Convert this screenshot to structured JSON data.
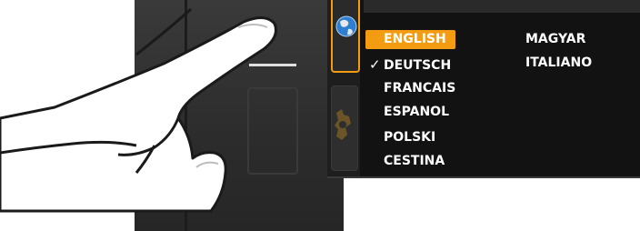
{
  "menu": {
    "left_column": [
      {
        "label": "ENGLISH",
        "selected": true,
        "checked": false
      },
      {
        "label": "DEUTSCH",
        "selected": false,
        "checked": true
      },
      {
        "label": "FRANCAIS",
        "selected": false,
        "checked": false
      },
      {
        "label": "ESPANOL",
        "selected": false,
        "checked": false
      },
      {
        "label": "POLSKI",
        "selected": false,
        "checked": false
      },
      {
        "label": "CESTINA",
        "selected": false,
        "checked": false
      }
    ],
    "right_column": [
      {
        "label": "MAGYAR"
      },
      {
        "label": "ITALIANO"
      }
    ],
    "check_glyph": "✓"
  },
  "rail": {
    "items": [
      {
        "icon": "globe-icon",
        "active": true
      },
      {
        "icon": "gear-icon",
        "active": false
      }
    ]
  },
  "colors": {
    "accent": "#f39c12",
    "screen_bg": "#121212",
    "text": "#ffffff"
  }
}
